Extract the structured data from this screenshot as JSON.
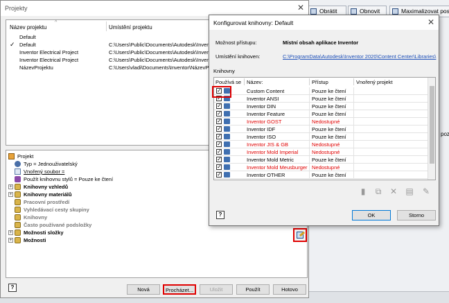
{
  "background": {
    "buttons": [
      {
        "label": "Obrátit",
        "icon": "refresh-icon"
      },
      {
        "label": "Obnovit",
        "icon": "refresh-icon"
      },
      {
        "label": "Maximalizovat pos",
        "icon": "maximize-icon"
      }
    ],
    "side_text": [
      "pozu"
    ]
  },
  "projects_dialog": {
    "title": "Projekty",
    "columns": [
      "Název projektu",
      "Umístění projektu"
    ],
    "projects": [
      {
        "name": "Default",
        "path": "",
        "active": false
      },
      {
        "name": "Default",
        "path": "C:\\Users\\Public\\Documents\\Autodesk\\Inventor",
        "active": true
      },
      {
        "name": "Inventor Electrical Project",
        "path": "C:\\Users\\Public\\Documents\\Autodesk\\Inventor",
        "active": false
      },
      {
        "name": "Inventor Electrical Project",
        "path": "C:\\Users\\Public\\Documents\\Autodesk\\Inventor",
        "active": false
      },
      {
        "name": "NázevProjektu",
        "path": "C:\\Users\\vladi\\Documents\\Inventor\\NázevProj",
        "active": false
      }
    ],
    "tree": {
      "root": "Projekt",
      "type": "Typ = Jednouživatelský",
      "include_file": "Vnořený soubor =",
      "library_style": "Použít knihovnu stylů = Pouze ke čtení",
      "appearance_libraries": "Knihovny vzhledů",
      "material_libraries": "Knihovny materiálů",
      "workspace": "Pracovní prostředí",
      "group_search_paths": "Vyhledávací cesty skupiny",
      "libraries": "Knihovny",
      "frequent_subfolders": "Často používané podsložky",
      "folder_options": "Možnosti složky",
      "options": "Možnosti"
    },
    "buttons": {
      "new": "Nová",
      "browse": "Procházet...",
      "save": "Uložit",
      "apply": "Použít",
      "done": "Hotovo"
    }
  },
  "config_dialog": {
    "title": "Konfigurovat knihovny: Default",
    "access_label": "Možnost přístupu:",
    "access_value": "Místní obsah aplikace Inventor",
    "location_label": "Umístění knihoven:",
    "location_value": "C:\\ProgramData\\Autodesk\\Inventor 2020\\Content Center\\Libraries\\",
    "libraries_label": "Knihovny",
    "columns": [
      "Používá se",
      "Název:",
      "Přístup",
      "Vnořený projekt"
    ],
    "libraries": [
      {
        "name": "Custom Content",
        "access": "Pouze ke čtení",
        "available": true
      },
      {
        "name": "Inventor ANSI",
        "access": "Pouze ke čtení",
        "available": true
      },
      {
        "name": "Inventor DIN",
        "access": "Pouze ke čtení",
        "available": true
      },
      {
        "name": "Inventor Feature",
        "access": "Pouze ke čtení",
        "available": true
      },
      {
        "name": "Inventor GOST",
        "access": "Nedostupné",
        "available": false
      },
      {
        "name": "Inventor IDF",
        "access": "Pouze ke čtení",
        "available": true
      },
      {
        "name": "Inventor ISO",
        "access": "Pouze ke čtení",
        "available": true
      },
      {
        "name": "Inventor JIS & GB",
        "access": "Nedostupné",
        "available": false
      },
      {
        "name": "Inventor Mold Imperial",
        "access": "Nedostupné",
        "available": false
      },
      {
        "name": "Inventor Mold Metric",
        "access": "Pouze ke čtení",
        "available": true
      },
      {
        "name": "Inventor Mold Meusburger",
        "access": "Nedostupné",
        "available": false
      },
      {
        "name": "Inventor OTHER",
        "access": "Pouze ke čtení",
        "available": true
      }
    ],
    "buttons": {
      "ok": "OK",
      "cancel": "Storno"
    },
    "colors": {
      "unavailable": "#e00000",
      "highlight": "#e00000"
    }
  }
}
